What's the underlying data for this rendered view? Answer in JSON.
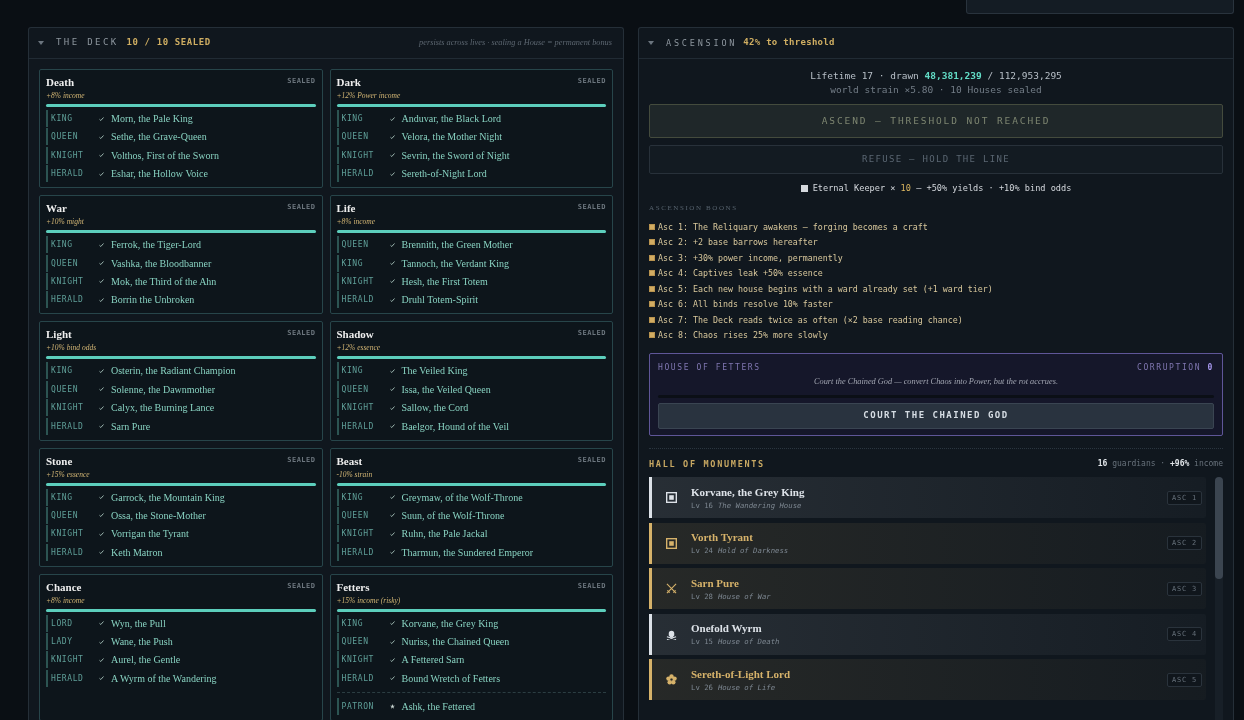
{
  "deck": {
    "title": "THE DECK",
    "expanded": true,
    "count": "10 / 10 SEALED",
    "note": "persists across lives · sealing a House = permanent bonus",
    "houses": [
      {
        "name": "Death",
        "status": "SEALED",
        "bonus": "+8% income",
        "level": 1,
        "members": [
          {
            "role": "KING",
            "name": "Morn, the Pale King",
            "kind": "sworn"
          },
          {
            "role": "QUEEN",
            "name": "Sethe, the Grave-Queen",
            "kind": "sworn"
          },
          {
            "role": "KNIGHT",
            "name": "Volthos, First of the Sworn",
            "kind": "sworn"
          },
          {
            "role": "HERALD",
            "name": "Eshar, the Hollow Voice",
            "kind": "sworn"
          }
        ]
      },
      {
        "name": "Dark",
        "status": "SEALED",
        "bonus": "+12% Power income",
        "level": 1,
        "members": [
          {
            "role": "KING",
            "name": "Anduvar, the Black Lord",
            "kind": "sworn"
          },
          {
            "role": "QUEEN",
            "name": "Velora, the Mother Night",
            "kind": "sworn"
          },
          {
            "role": "KNIGHT",
            "name": "Sevrin, the Sword of Night",
            "kind": "sworn"
          },
          {
            "role": "HERALD",
            "name": "Sereth-of-Night Lord",
            "kind": "sworn"
          }
        ]
      },
      {
        "name": "War",
        "status": "SEALED",
        "bonus": "+10% might",
        "level": 1,
        "members": [
          {
            "role": "KING",
            "name": "Ferrok, the Tiger-Lord",
            "kind": "sworn"
          },
          {
            "role": "QUEEN",
            "name": "Vashka, the Bloodbanner",
            "kind": "sworn"
          },
          {
            "role": "KNIGHT",
            "name": "Mok, the Third of the Ahn",
            "kind": "sworn"
          },
          {
            "role": "HERALD",
            "name": "Borrin the Unbroken",
            "kind": "sworn"
          }
        ]
      },
      {
        "name": "Life",
        "status": "SEALED",
        "bonus": "+8% income",
        "level": 1,
        "members": [
          {
            "role": "QUEEN",
            "name": "Brennith, the Green Mother",
            "kind": "sworn"
          },
          {
            "role": "KING",
            "name": "Tannoch, the Verdant King",
            "kind": "sworn"
          },
          {
            "role": "KNIGHT",
            "name": "Hesh, the First Totem",
            "kind": "sworn"
          },
          {
            "role": "HERALD",
            "name": "Druhl Totem-Spirit",
            "kind": "sworn"
          }
        ]
      },
      {
        "name": "Light",
        "status": "SEALED",
        "bonus": "+10% bind odds",
        "level": 1,
        "members": [
          {
            "role": "KING",
            "name": "Osterin, the Radiant Champion",
            "kind": "sworn"
          },
          {
            "role": "QUEEN",
            "name": "Solenne, the Dawnmother",
            "kind": "sworn"
          },
          {
            "role": "KNIGHT",
            "name": "Calyx, the Burning Lance",
            "kind": "sworn"
          },
          {
            "role": "HERALD",
            "name": "Sarn Pure",
            "kind": "sworn"
          }
        ]
      },
      {
        "name": "Shadow",
        "status": "SEALED",
        "bonus": "+12% essence",
        "level": 1,
        "members": [
          {
            "role": "KING",
            "name": "The Veiled King",
            "kind": "sworn"
          },
          {
            "role": "QUEEN",
            "name": "Issa, the Veiled Queen",
            "kind": "sworn"
          },
          {
            "role": "KNIGHT",
            "name": "Sallow, the Cord",
            "kind": "sworn"
          },
          {
            "role": "HERALD",
            "name": "Baelgor, Hound of the Veil",
            "kind": "sworn"
          }
        ]
      },
      {
        "name": "Stone",
        "status": "SEALED",
        "bonus": "+15% essence",
        "level": 1,
        "members": [
          {
            "role": "KING",
            "name": "Garrock, the Mountain King",
            "kind": "sworn"
          },
          {
            "role": "QUEEN",
            "name": "Ossa, the Stone-Mother",
            "kind": "sworn"
          },
          {
            "role": "KNIGHT",
            "name": "Vorrigan the Tyrant",
            "kind": "sworn"
          },
          {
            "role": "HERALD",
            "name": "Keth Matron",
            "kind": "sworn"
          }
        ]
      },
      {
        "name": "Beast",
        "status": "SEALED",
        "bonus": "-10% strain",
        "level": 1,
        "members": [
          {
            "role": "KING",
            "name": "Greymaw, of the Wolf-Throne",
            "kind": "sworn"
          },
          {
            "role": "QUEEN",
            "name": "Suun, of the Wolf-Throne",
            "kind": "sworn"
          },
          {
            "role": "KNIGHT",
            "name": "Ruhn, the Pale Jackal",
            "kind": "sworn"
          },
          {
            "role": "HERALD",
            "name": "Tharmun, the Sundered Emperor",
            "kind": "sworn"
          }
        ]
      },
      {
        "name": "Chance",
        "status": "SEALED",
        "bonus": "+8% income",
        "level": 1,
        "members": [
          {
            "role": "LORD",
            "name": "Wyn, the Pull",
            "kind": "sworn"
          },
          {
            "role": "LADY",
            "name": "Wane, the Push",
            "kind": "sworn"
          },
          {
            "role": "KNIGHT",
            "name": "Aurel, the Gentle",
            "kind": "sworn"
          },
          {
            "role": "HERALD",
            "name": "A Wyrm of the Wandering",
            "kind": "sworn"
          }
        ]
      },
      {
        "name": "Fetters",
        "status": "SEALED",
        "bonus": "+15% income (risky)",
        "level": 1,
        "members": [
          {
            "role": "KING",
            "name": "Korvane, the Grey King",
            "kind": "sworn"
          },
          {
            "role": "QUEEN",
            "name": "Nuriss, the Chained Queen",
            "kind": "sworn"
          },
          {
            "role": "KNIGHT",
            "name": "A Fettered Sarn",
            "kind": "sworn"
          },
          {
            "role": "HERALD",
            "name": "Bound Wretch of Fetters",
            "kind": "sworn"
          },
          {
            "role": "PATRON",
            "name": "Ashk, the Fettered",
            "kind": "patron"
          }
        ]
      }
    ]
  },
  "ascension": {
    "title": "ASCENSION",
    "expanded": true,
    "progress_label": "42% to threshold",
    "lifetime": "Lifetime 17 · drawn **48,381,239** / 112,953,295",
    "strain": "world strain ×5.80 · 10 Houses sealed",
    "buttons": [
      {
        "label": "ASCEND — THRESHOLD NOT REACHED",
        "kind": "primary",
        "disabled": true
      },
      {
        "label": "REFUSE — HOLD THE LINE",
        "kind": "secondary",
        "disabled": true
      }
    ],
    "keeper": "Eternal Keeper × **10** — +50% yields · +10% bind odds",
    "boons_heading": "ASCENSION BOONS",
    "boons": [
      "Asc 1: The Reliquary awakens — forging becomes a craft",
      "Asc 2: +2 base barrows hereafter",
      "Asc 3: +30% power income, permanently",
      "Asc 4: Captives leak +50% essence",
      "Asc 5: Each new house begins with a ward already set (+1 ward tier)",
      "Asc 6: All binds resolve 10% faster",
      "Asc 7: The Deck reads twice as often (×2 base reading chance)",
      "Asc 8: Chaos rises 25% more slowly"
    ],
    "fetters": {
      "title": "HOUSE OF FETTERS",
      "corruption": "CORRUPTION **0**",
      "description": "Court the Chained God — convert Chaos into Power, but the rot accrues.",
      "level": 0,
      "button": "COURT THE CHAINED GOD"
    },
    "monuments": {
      "title": "HALL OF MONUMENTS",
      "summary": "**16** guardians · **+96%** income",
      "items": [
        {
          "name": "Korvane, the Grey King",
          "level": "Lv 16",
          "house": "The Wandering House",
          "badge": "ASC 1",
          "kind": "square",
          "color": "#dde2e8"
        },
        {
          "name": "Vorth Tyrant",
          "level": "Lv 24",
          "house": "Hold of Darkness",
          "badge": "ASC 2",
          "kind": "square",
          "color": "#d6b26a"
        },
        {
          "name": "Sarn Pure",
          "level": "Lv 28",
          "house": "House of War",
          "badge": "ASC 3",
          "kind": "swords",
          "color": "#d6b26a"
        },
        {
          "name": "Onefold Wyrm",
          "level": "Lv 15",
          "house": "House of Death",
          "badge": "ASC 4",
          "kind": "skull",
          "color": "#dde2e8"
        },
        {
          "name": "Sereth-of-Light Lord",
          "level": "Lv 26",
          "house": "House of Life",
          "badge": "ASC 5",
          "kind": "flower",
          "color": "#d6b26a"
        }
      ]
    }
  }
}
